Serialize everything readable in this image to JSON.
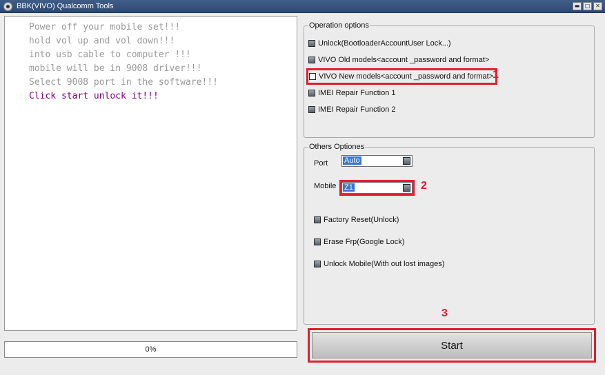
{
  "window": {
    "title": "BBK(VIVO) Qualcomm Tools",
    "controls": [
      {
        "name": "minimize",
        "glyph": "▬"
      },
      {
        "name": "maximize",
        "glyph": "□"
      },
      {
        "name": "close",
        "glyph": "✕"
      }
    ]
  },
  "log": {
    "lines": [
      {
        "text": "Power off your mobile set!!!",
        "color": "#999999"
      },
      {
        "text": "hold vol up and vol down!!!",
        "color": "#999999"
      },
      {
        "text": "into usb cable to computer !!!",
        "color": "#999999"
      },
      {
        "text": "mobile will be in 9008 driver!!!",
        "color": "#999999"
      },
      {
        "text": "Select 9008 port in the software!!!",
        "color": "#999999"
      },
      {
        "text": "Click start unlock it!!!",
        "color": "#800080"
      }
    ]
  },
  "progress": {
    "percent": 0,
    "text": "0%"
  },
  "operation_options": {
    "title": "Operation options",
    "items": [
      {
        "label": "Unlock(BootloaderAccountUser Lock...)",
        "checked": false,
        "highlighted": false
      },
      {
        "label": "VIVO Old models<account _password and format>",
        "checked": false,
        "highlighted": false
      },
      {
        "label": "VIVO New models<account _password and format>",
        "checked": true,
        "highlighted": true
      },
      {
        "label": "IMEI Repair Function 1",
        "checked": false,
        "highlighted": false
      },
      {
        "label": "IMEI Repair Function 2",
        "checked": false,
        "highlighted": false
      }
    ]
  },
  "others_options": {
    "title": "Others Optiones",
    "port": {
      "label": "Port",
      "value": "Auto"
    },
    "mobile": {
      "label": "Mobile",
      "value": "Z1"
    },
    "checks": [
      {
        "label": "Factory Reset(Unlock)"
      },
      {
        "label": "Erase Frp(Google Lock)"
      },
      {
        "label": "Unlock Mobile(With out lost images)"
      }
    ]
  },
  "markers": {
    "one": "1",
    "two": "2",
    "three": "3"
  },
  "start_button": {
    "label": "Start"
  },
  "colors": {
    "highlight": "#e11d2d",
    "log_text": "#999999",
    "log_accent": "#800080",
    "selection": "#3875d7"
  }
}
